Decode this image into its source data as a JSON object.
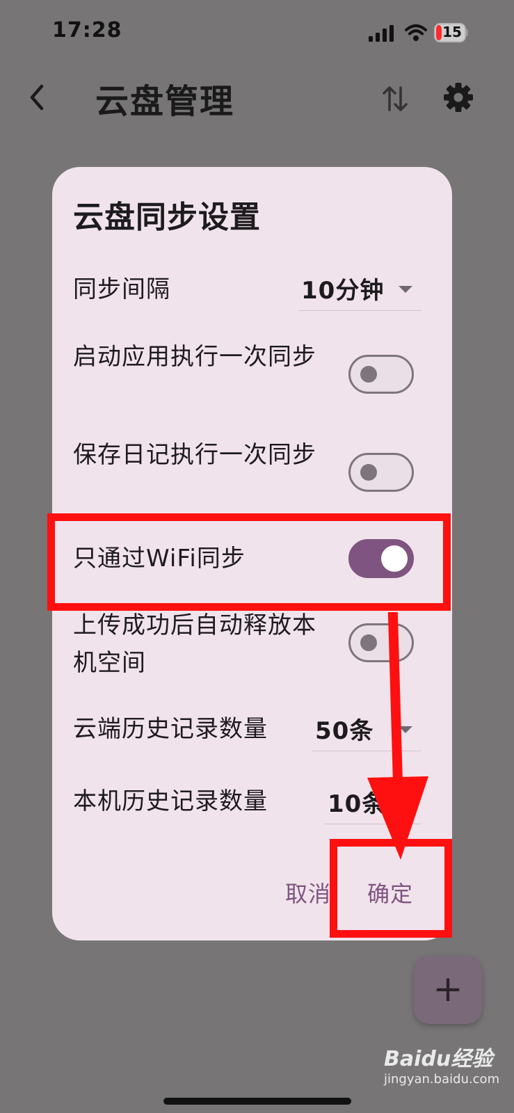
{
  "status_bar": {
    "time": "17:28",
    "battery_level": "15",
    "signal_icon": "cellular-signal-icon",
    "wifi_icon": "wifi-icon",
    "battery_icon": "battery-low-icon"
  },
  "app_bar": {
    "title": "云盘管理",
    "back_icon": "chevron-left-icon",
    "sort_icon": "sort-arrows-icon",
    "settings_icon": "gear-icon"
  },
  "dialog": {
    "title": "云盘同步设置",
    "rows": [
      {
        "label": "同步间隔",
        "value": "10分钟"
      },
      {
        "label": "启动应用执行一次同步",
        "on": false
      },
      {
        "label": "保存日记执行一次同步",
        "on": false
      },
      {
        "label": "只通过WiFi同步",
        "on": true
      },
      {
        "label": "上传成功后自动释放本机空间",
        "on": false
      },
      {
        "label": "云端历史记录数量",
        "value": "50条"
      },
      {
        "label": "本机历史记录数量",
        "value": "10条"
      }
    ],
    "cancel_label": "取消",
    "confirm_label": "确定"
  },
  "fab": {
    "label": "+"
  },
  "watermark": {
    "logo": "Baidu经验",
    "sub": "jingyan.baidu.com"
  },
  "colors": {
    "accent": "#7f5480",
    "dialog_bg": "#f1e3ec",
    "scrim": "#777576",
    "highlight": "#ff1010"
  }
}
